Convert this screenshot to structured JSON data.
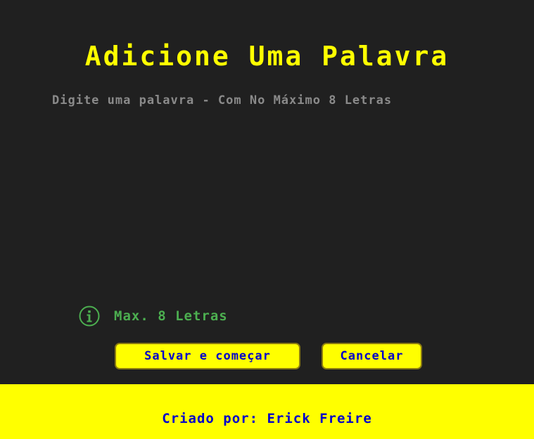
{
  "page": {
    "title": "Adicione Uma Palavra"
  },
  "word_input": {
    "placeholder": "Digite uma palavra - Com No Máximo 8 Letras",
    "value": ""
  },
  "info": {
    "icon": "info-circle-icon",
    "text": "Max. 8 Letras"
  },
  "buttons": {
    "save_label": "Salvar e começar",
    "cancel_label": "Cancelar"
  },
  "footer": {
    "credit": "Criado por: Erick Freire"
  },
  "colors": {
    "background": "#202020",
    "accent": "#ffff00",
    "button_text": "#0000cc",
    "info_green": "#4caf50",
    "placeholder": "#8a8a8a"
  }
}
